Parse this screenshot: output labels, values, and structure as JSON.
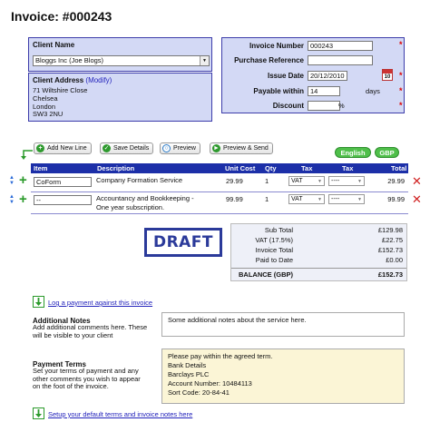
{
  "invoice_title": "Invoice: #000243",
  "client": {
    "name_label": "Client Name",
    "name_value": "Bloggs Inc (Joe Blogs)",
    "address_label": "Client Address",
    "address_modify": "(Modify)",
    "address_lines": [
      "71 Wiltshire Close",
      "Chelsea",
      "London",
      "SW3 2NU"
    ]
  },
  "details": {
    "invoice_number_label": "Invoice Number",
    "invoice_number_value": "000243",
    "po_label": "Purchase Reference",
    "po_value": "",
    "issue_date_label": "Issue Date",
    "issue_date_value": "20/12/2010",
    "calendar_day": "10",
    "payable_label": "Payable within",
    "payable_value": "14",
    "payable_unit": "days",
    "discount_label": "Discount",
    "discount_value": "",
    "discount_unit": "%",
    "required_mark": "*"
  },
  "toolbar": {
    "add_line": "Add New Line",
    "save": "Save Details",
    "preview": "Preview",
    "preview_send": "Preview & Send",
    "language": "English",
    "currency": "GBP"
  },
  "table": {
    "headers": [
      "Item",
      "Description",
      "Unit Cost",
      "Qty",
      "Tax",
      "Tax",
      "Total"
    ],
    "rows": [
      {
        "item": "CoForm",
        "description": [
          "Company Formation Service"
        ],
        "unit_cost": "29.99",
        "qty": "1",
        "tax1": "VAT",
        "tax2": "----",
        "total": "29.99"
      },
      {
        "item": "--",
        "description": [
          "Accountancy and Bookkeeping -",
          "One year subscription."
        ],
        "unit_cost": "99.99",
        "qty": "1",
        "tax1": "VAT",
        "tax2": "----",
        "total": "99.99"
      }
    ]
  },
  "stamp": "DRAFT",
  "totals": [
    {
      "label": "Sub Total",
      "value": "£129.98"
    },
    {
      "label": "VAT (17.5%)",
      "value": "£22.75"
    },
    {
      "label": "Invoice Total",
      "value": "£152.73"
    },
    {
      "label": "Paid to Date",
      "value": "£0.00"
    }
  ],
  "balance": {
    "label": "BALANCE (GBP)",
    "value": "£152.73"
  },
  "log_payment": "Log a payment against this invoice",
  "notes": {
    "title": "Additional Notes",
    "help": [
      "Add additional comments here. These",
      "will be visible to your client"
    ],
    "value": "Some additional notes about the service here."
  },
  "terms": {
    "title": "Payment Terms",
    "help": [
      "Set your terms of payment and any",
      "other comments you wish to appear",
      "on the foot of the invoice."
    ],
    "value_lines": [
      "Please pay within the agreed term.",
      "Bank Details",
      "Barclays PLC",
      "Account Number: 10484113",
      "Sort Code: 20-84-41"
    ]
  },
  "setup_link": "Setup your default terms and invoice notes here",
  "colors": {
    "header_blue": "#1c2fa8",
    "box_blue": "#d3d9f5",
    "button_green": "#4fbf4a",
    "delete_red": "#d02020"
  }
}
